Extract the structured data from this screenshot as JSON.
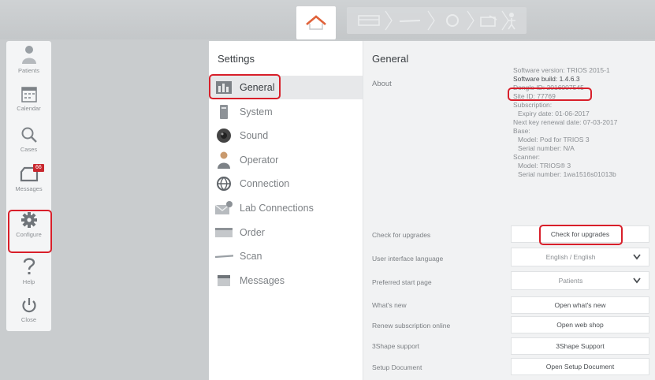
{
  "workflow": {
    "steps": [
      "home-icon",
      "order-icon",
      "scan-icon",
      "post-processing-icon",
      "send-icon",
      "patient-icon"
    ]
  },
  "leftnav": {
    "items": [
      {
        "label": "Patients",
        "icon": "patients-icon"
      },
      {
        "label": "Calendar",
        "icon": "calendar-icon"
      },
      {
        "label": "Cases",
        "icon": "search-icon"
      },
      {
        "label": "Messages",
        "icon": "messages-icon",
        "badge": "66"
      },
      {
        "label": "Configure",
        "icon": "gear-icon"
      },
      {
        "label": "Help",
        "icon": "help-icon"
      },
      {
        "label": "Close",
        "icon": "power-icon"
      }
    ]
  },
  "settings": {
    "title": "Settings",
    "items": [
      {
        "label": "General",
        "icon": "general-icon",
        "active": true
      },
      {
        "label": "System",
        "icon": "system-icon"
      },
      {
        "label": "Sound",
        "icon": "sound-icon"
      },
      {
        "label": "Operator",
        "icon": "operator-icon"
      },
      {
        "label": "Connection",
        "icon": "connection-icon"
      },
      {
        "label": "Lab Connections",
        "icon": "lab-connections-icon"
      },
      {
        "label": "Order",
        "icon": "order-icon"
      },
      {
        "label": "Scan",
        "icon": "scan-icon"
      },
      {
        "label": "Messages",
        "icon": "messages-list-icon"
      }
    ]
  },
  "general": {
    "title": "General",
    "about_label": "About",
    "about": {
      "software_version": "Software version: TRIOS 2015-1",
      "software_build": "Software build: 1.4.6.3",
      "dongle_id": "Dongle ID: 2016007545",
      "site_id": "Site ID: 77769",
      "subscription": "Subscription:",
      "expiry": "Expiry date: 01-06-2017",
      "renewal": "Next key renewal date: 07-03-2017",
      "base": "Base:",
      "base_model": "Model: Pod for TRIOS 3",
      "base_serial": "Serial number: N/A",
      "scanner": "Scanner:",
      "scanner_model": "Model: TRIOS® 3",
      "scanner_serial": "Serial number: 1wa1516s01013b"
    },
    "rows": {
      "check_upgrades_label": "Check for upgrades",
      "check_upgrades_button": "Check for upgrades",
      "ui_language_label": "User interface language",
      "ui_language_value": "English / English",
      "start_page_label": "Preferred start page",
      "start_page_value": "Patients",
      "whats_new_label": "What's new",
      "whats_new_button": "Open what's new",
      "renew_label": "Renew subscription online",
      "renew_button": "Open web shop",
      "support_label": "3Shape support",
      "support_button": "3Shape Support",
      "setup_label": "Setup Document",
      "setup_button": "Open Setup Document"
    }
  },
  "colors": {
    "highlight": "#d81f2a",
    "home_accent": "#e0623a",
    "badge": "#c8272e"
  }
}
